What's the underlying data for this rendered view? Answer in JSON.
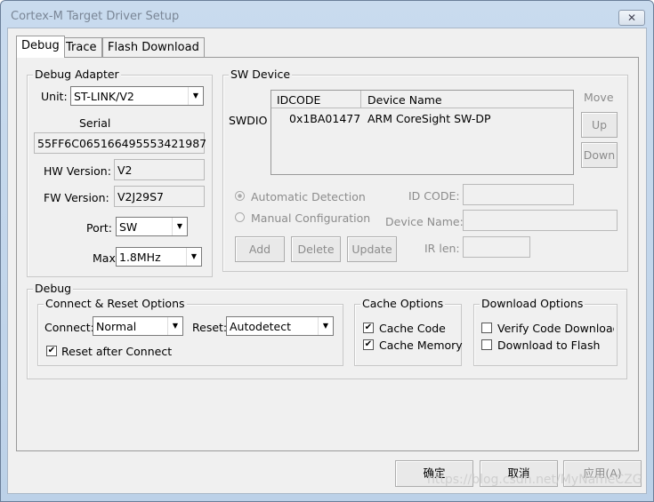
{
  "window": {
    "title": "Cortex-M Target Driver Setup",
    "close_icon": "close-icon"
  },
  "tabs": [
    "Debug",
    "Trace",
    "Flash Download"
  ],
  "debug_adapter": {
    "title": "Debug Adapter",
    "unit_label": "Unit:",
    "unit_value": "ST-LINK/V2",
    "serial_label": "Serial",
    "serial_value": "55FF6C065166495553421987",
    "hw_label": "HW Version:",
    "hw_value": "V2",
    "fw_label": "FW Version:",
    "fw_value": "V2J29S7",
    "port_label": "Port:",
    "port_value": "SW",
    "max_label": "Max",
    "max_value": "1.8MHz"
  },
  "sw_device": {
    "title": "SW Device",
    "row_label": "SWDIO",
    "columns": [
      "IDCODE",
      "Device Name"
    ],
    "rows": [
      {
        "idcode": "0x1BA01477",
        "name": "ARM CoreSight SW-DP"
      }
    ],
    "move_label": "Move",
    "up": "Up",
    "down": "Down",
    "auto_detect": "Automatic Detection",
    "manual_config": "Manual Configuration",
    "id_code_label": "ID CODE:",
    "device_name_label": "Device Name:",
    "ir_len_label": "IR len:",
    "add": "Add",
    "delete": "Delete",
    "update": "Update"
  },
  "debug": {
    "title": "Debug",
    "connect_reset": {
      "title": "Connect & Reset Options",
      "connect_label": "Connect:",
      "connect_value": "Normal",
      "reset_label": "Reset:",
      "reset_value": "Autodetect",
      "reset_after_connect": "Reset after Connect",
      "reset_after_connect_checked": true
    },
    "cache": {
      "title": "Cache Options",
      "cache_code": "Cache Code",
      "cache_code_checked": true,
      "cache_memory": "Cache Memory",
      "cache_memory_checked": true
    },
    "download": {
      "title": "Download Options",
      "verify": "Verify Code Download",
      "verify_checked": false,
      "to_flash": "Download to Flash",
      "to_flash_checked": false
    }
  },
  "buttons": {
    "ok": "确定",
    "cancel": "取消",
    "apply": "应用(A)"
  },
  "watermark": "https://blog.csdn.net/MyNameCZG"
}
